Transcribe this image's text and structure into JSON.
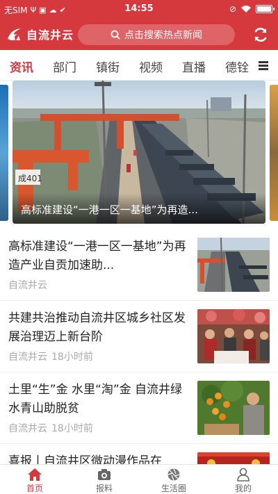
{
  "status_bar": {
    "carrier": "无SIM",
    "time": "14:55"
  },
  "header": {
    "app_name": "自流井云",
    "search_placeholder": "点击搜索热点新闻",
    "brand_color": "#d6393d"
  },
  "tabs": [
    {
      "label": "资讯",
      "active": true
    },
    {
      "label": "部门",
      "active": false
    },
    {
      "label": "镇街",
      "active": false
    },
    {
      "label": "视频",
      "active": false
    },
    {
      "label": "直播",
      "active": false
    },
    {
      "label": "德铨",
      "active": false
    }
  ],
  "carousel": {
    "caption": "高标准建设“一港一区一基地”为再造..."
  },
  "news": [
    {
      "title": "高标准建设“一港一区一基地”为再造产业自贡加速助...",
      "source": "自流井云",
      "time": "",
      "thumb": "port-icon"
    },
    {
      "title": "共建共治推动自流井区城乡社区发展治理迈上新台阶",
      "source": "自流井云",
      "time": "18小时前",
      "thumb": "community-icon"
    },
    {
      "title": "土里“生”金 水里“淘”金 自流井绿水青山助脱贫",
      "source": "自流井云",
      "time": "18小时前",
      "thumb": "orchard-icon"
    },
    {
      "title": "喜报丨自流井区微动漫作品在",
      "source": "",
      "time": "",
      "thumb": "banner-icon"
    }
  ],
  "bottom_nav": [
    {
      "label": "首页",
      "icon": "home-icon",
      "active": true
    },
    {
      "label": "报料",
      "icon": "camera-icon",
      "active": false
    },
    {
      "label": "生活圈",
      "icon": "aperture-icon",
      "active": false
    },
    {
      "label": "我的",
      "icon": "user-icon",
      "active": false
    }
  ]
}
